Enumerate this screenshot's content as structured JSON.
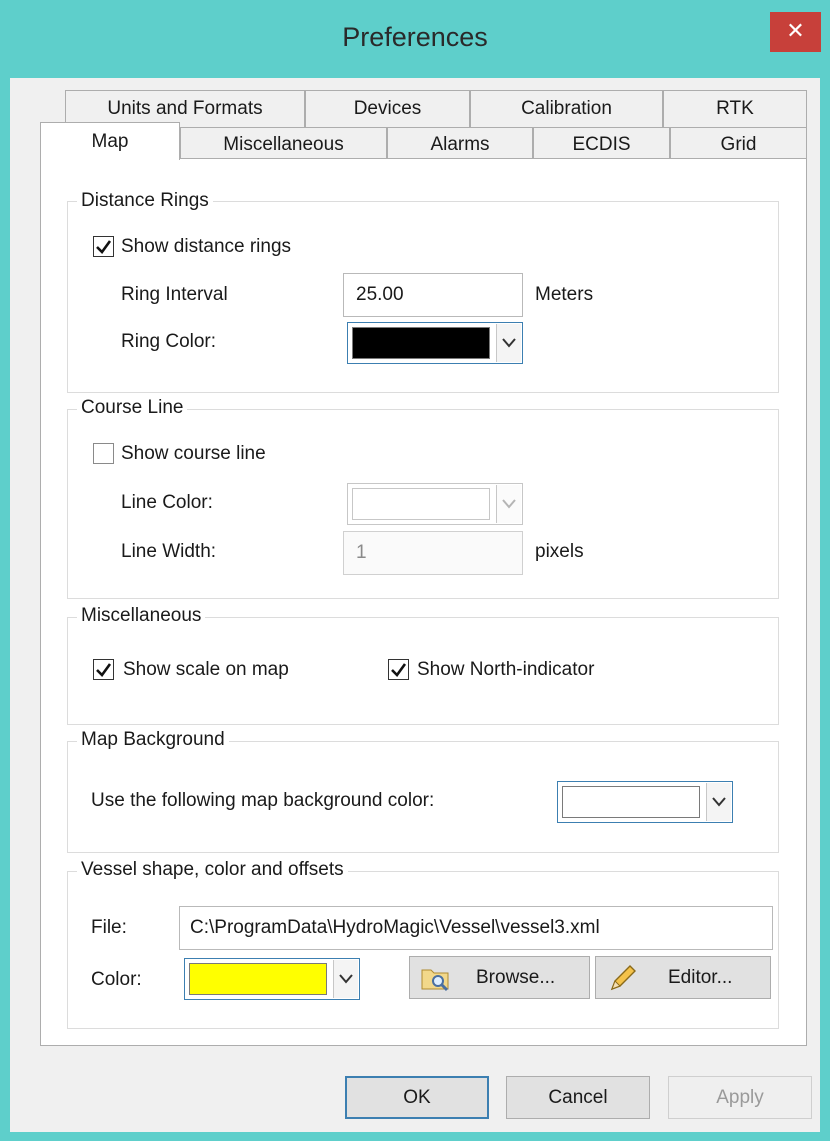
{
  "window": {
    "title": "Preferences",
    "close_glyph": "✕"
  },
  "tabs": {
    "row1": [
      "Units and Formats",
      "Devices",
      "Calibration",
      "RTK"
    ],
    "row2": [
      "Map",
      "Miscellaneous",
      "Alarms",
      "ECDIS",
      "Grid"
    ],
    "active": "Map"
  },
  "distance_rings": {
    "title": "Distance Rings",
    "show_label": "Show distance rings",
    "show_checked": true,
    "interval_label": "Ring Interval",
    "interval_value": "25.00",
    "interval_unit": "Meters",
    "color_label": "Ring Color:",
    "color_value": "#000000"
  },
  "course_line": {
    "title": "Course Line",
    "show_label": "Show course line",
    "show_checked": false,
    "color_label": "Line Color:",
    "color_value": "#ffffff",
    "width_label": "Line Width:",
    "width_value": "1",
    "width_unit": "pixels"
  },
  "misc": {
    "title": "Miscellaneous",
    "scale_label": "Show scale on map",
    "scale_checked": true,
    "north_label": "Show North-indicator",
    "north_checked": true
  },
  "map_background": {
    "title": "Map Background",
    "label": "Use the following map background color:",
    "color_value": "#ffffff"
  },
  "vessel": {
    "title": "Vessel shape, color and offsets",
    "file_label": "File:",
    "file_value": "C:\\ProgramData\\HydroMagic\\Vessel\\vessel3.xml",
    "color_label": "Color:",
    "color_value": "#ffff00",
    "browse_label": "Browse...",
    "editor_label": "Editor...",
    "browse_icon": "folder-search-icon",
    "editor_icon": "pencil-icon"
  },
  "buttons": {
    "ok": "OK",
    "cancel": "Cancel",
    "apply": "Apply"
  }
}
